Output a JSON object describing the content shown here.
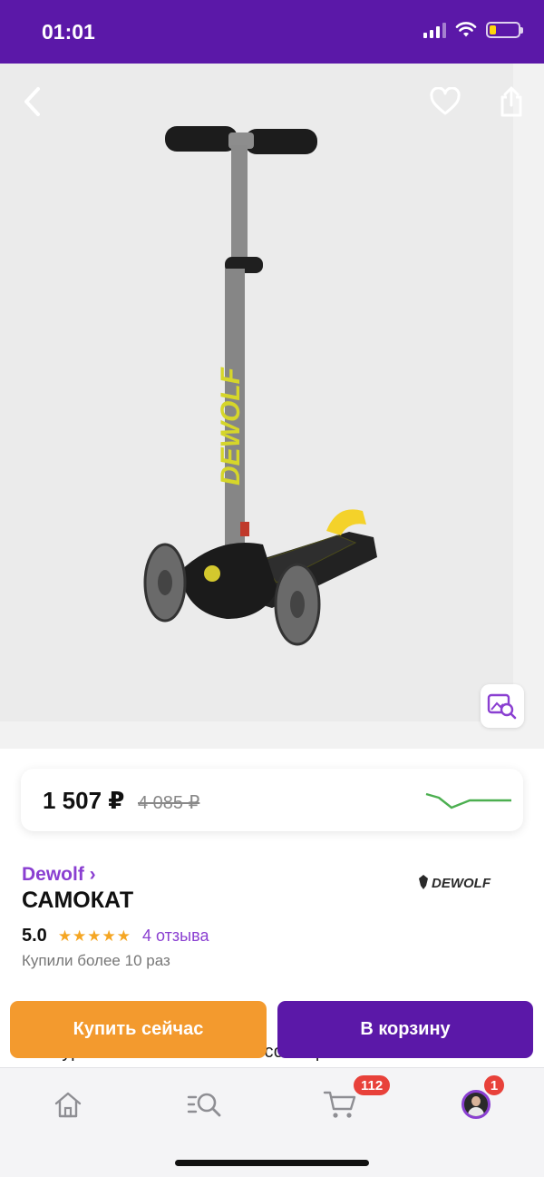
{
  "status_bar": {
    "time": "01:01",
    "signal_icon": "cellular-signal-icon",
    "wifi_icon": "wifi-icon",
    "battery_icon": "battery-low-icon",
    "battery_level": 0.2
  },
  "header": {
    "back_icon": "chevron-left-icon",
    "favorite_icon": "heart-outline-icon",
    "share_icon": "share-icon",
    "image_search_icon": "image-search-icon"
  },
  "product_image": {
    "brand_text": "DEWOLF"
  },
  "price": {
    "current": "1 507 ₽",
    "old": "4 085 ₽",
    "graph_icon": "price-history-graph-icon"
  },
  "product": {
    "brand": "Dewolf ›",
    "brand_logo_text": "DEWOLF",
    "title": "САМОКАТ",
    "rating": "5.0",
    "stars": "★★★★★",
    "reviews": "4 отзыва",
    "bought": "Купили более 10 раз",
    "description": "полиуретановыми колесами со встроенными"
  },
  "actions": {
    "buy_now": "Купить сейчас",
    "add_to_cart": "В корзину"
  },
  "tab_bar": {
    "home_icon": "home-icon",
    "search_icon": "catalog-search-icon",
    "cart_icon": "cart-icon",
    "cart_badge": "112",
    "profile_icon": "profile-avatar",
    "profile_badge": "1"
  },
  "colors": {
    "brand_purple": "#5b18a8",
    "link_purple": "#8a3fd1",
    "buy_orange": "#f39a2e",
    "badge_red": "#e8413a",
    "star_orange": "#f5a623",
    "graph_green": "#4caf50"
  }
}
